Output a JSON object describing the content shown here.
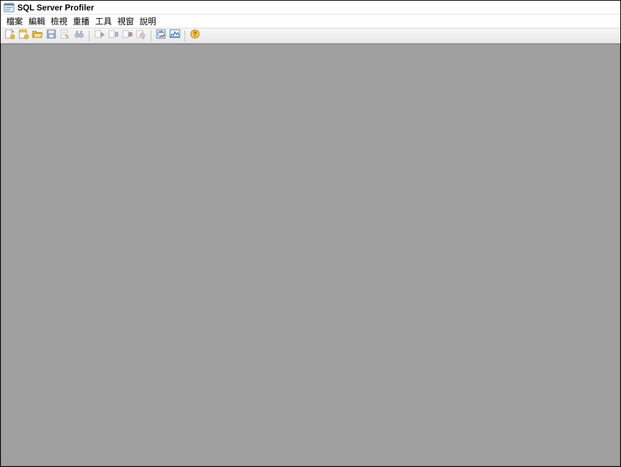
{
  "title": "SQL Server Profiler",
  "menu": {
    "file": "檔案",
    "edit": "編輯",
    "view": "檢視",
    "replay": "重播",
    "tools": "工具",
    "window": "視窗",
    "help": "說明"
  },
  "toolbar": {
    "new_trace": "new-trace",
    "new_template": "new-template",
    "open_file": "open-file",
    "save": "save",
    "properties": "properties",
    "find": "find",
    "run_trace": "run-trace",
    "pause_trace": "pause-trace",
    "stop_trace": "stop-trace",
    "clear_trace_window": "clear-trace-window",
    "database_tuning": "database-tuning-advisor",
    "activity_monitor": "activity-monitor",
    "help_button": "help"
  }
}
